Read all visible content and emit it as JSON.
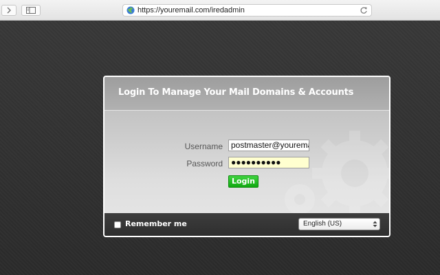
{
  "browser": {
    "url": "https://youremail.com/iredadmin",
    "icons": {
      "forward": "chevron-right-icon",
      "sidebar": "sidebar-icon",
      "site": "globe-icon",
      "reload": "reload-icon"
    }
  },
  "login": {
    "title": "Login To Manage Your Mail Domains & Accounts",
    "username_label": "Username",
    "username_value": "postmaster@youremai",
    "password_label": "Password",
    "password_masked": "●●●●●●●●●●",
    "login_button": "Login",
    "remember_me": "Remember me",
    "language_selected": "English (US)"
  },
  "colors": {
    "accent_green": "#1cb81c",
    "password_field_bg": "#ffffd0",
    "page_bg": "#2f2f2f"
  }
}
